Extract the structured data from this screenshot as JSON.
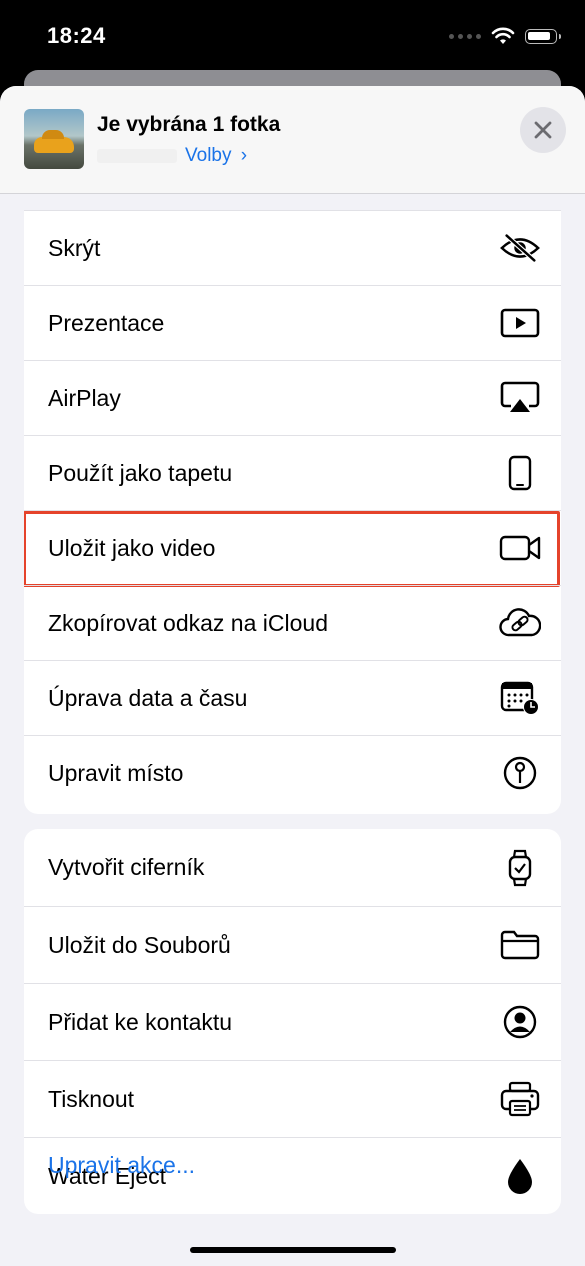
{
  "status_bar": {
    "time": "18:24"
  },
  "header": {
    "title": "Je vybrána 1 fotka",
    "options_label": "Volby",
    "options_chevron": "›"
  },
  "group1": {
    "items": [
      {
        "label": "Skrýt",
        "icon": "eye-slash-icon"
      },
      {
        "label": "Prezentace",
        "icon": "play-rectangle-icon"
      },
      {
        "label": "AirPlay",
        "icon": "airplay-icon"
      },
      {
        "label": "Použít jako tapetu",
        "icon": "iphone-icon"
      },
      {
        "label": "Uložit jako video",
        "icon": "video-camera-icon"
      },
      {
        "label": "Zkopírovat odkaz na iCloud",
        "icon": "icloud-link-icon"
      },
      {
        "label": "Úprava data a času",
        "icon": "calendar-clock-icon"
      },
      {
        "label": "Upravit místo",
        "icon": "map-pin-icon"
      }
    ]
  },
  "group2": {
    "items": [
      {
        "label": "Vytvořit ciferník",
        "icon": "watch-icon"
      },
      {
        "label": "Uložit do Souborů",
        "icon": "folder-icon"
      },
      {
        "label": "Přidat ke kontaktu",
        "icon": "person-circle-icon"
      },
      {
        "label": "Tisknout",
        "icon": "printer-icon"
      },
      {
        "label": "Water Eject",
        "icon": "drop-icon"
      }
    ]
  },
  "edit_actions_label": "Upravit akce...",
  "colors": {
    "accent": "#1a73e8",
    "highlight": "#e5432b"
  }
}
